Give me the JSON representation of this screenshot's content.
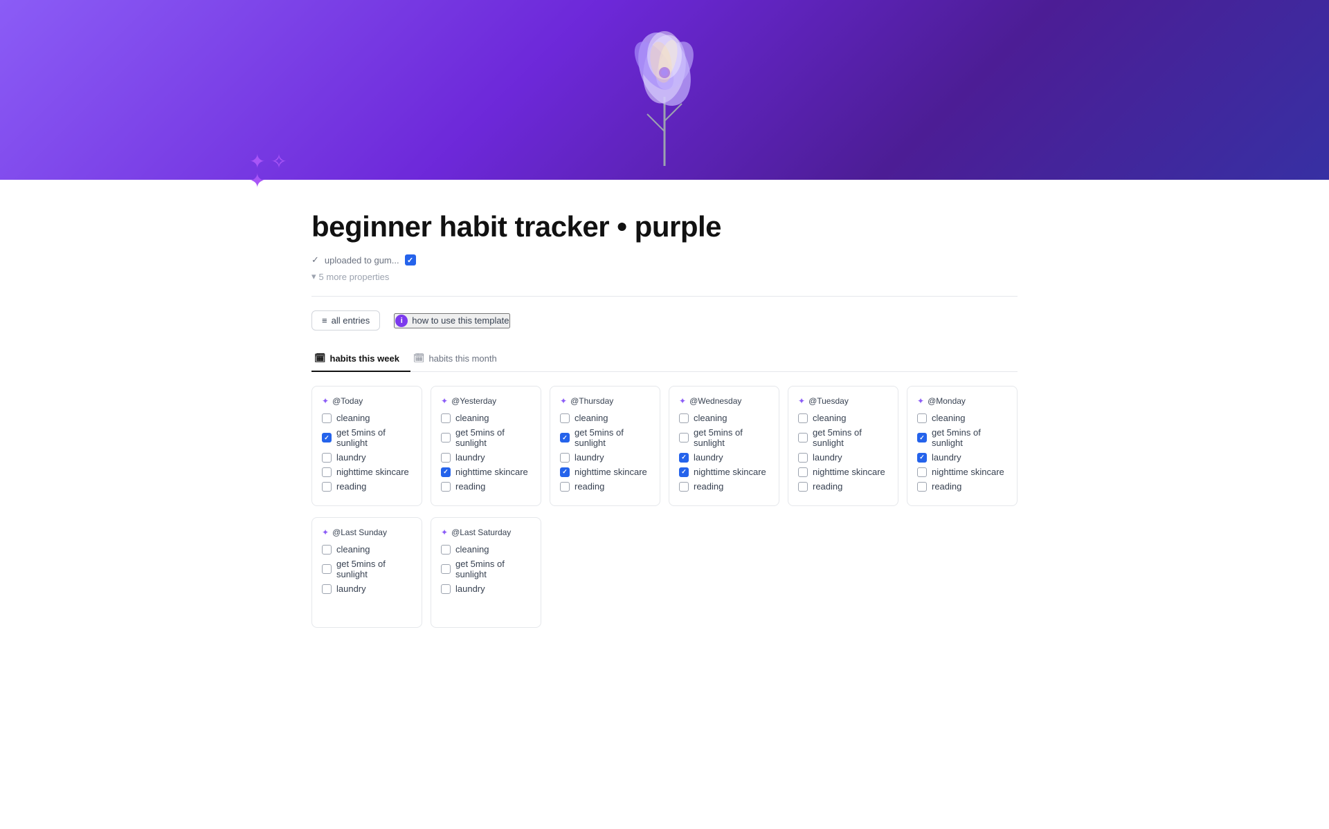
{
  "header": {
    "banner_gradient": "purple",
    "sparkles": "✦ ✧ ✦"
  },
  "page": {
    "title": "beginner habit tracker • purple",
    "property_label": "uploaded to gum...",
    "property_checked": true,
    "more_properties": "5 more properties"
  },
  "actions": {
    "all_entries_label": "all entries",
    "how_to_label": "how to use this template"
  },
  "tabs": [
    {
      "id": "week",
      "label": "habits this week",
      "active": true,
      "icon": "📅"
    },
    {
      "id": "month",
      "label": "habits this month",
      "active": false,
      "icon": "📅"
    }
  ],
  "habits_this_week": [
    {
      "day": "@Today",
      "habits": [
        {
          "label": "cleaning",
          "checked": false
        },
        {
          "label": "get 5mins of sunlight",
          "checked": true
        },
        {
          "label": "laundry",
          "checked": false
        },
        {
          "label": "nighttime skincare",
          "checked": false
        },
        {
          "label": "reading",
          "checked": false
        }
      ]
    },
    {
      "day": "@Yesterday",
      "habits": [
        {
          "label": "cleaning",
          "checked": false
        },
        {
          "label": "get 5mins of sunlight",
          "checked": false
        },
        {
          "label": "laundry",
          "checked": false
        },
        {
          "label": "nighttime skincare",
          "checked": true
        },
        {
          "label": "reading",
          "checked": false
        }
      ]
    },
    {
      "day": "@Thursday",
      "habits": [
        {
          "label": "cleaning",
          "checked": false
        },
        {
          "label": "get 5mins of sunlight",
          "checked": true
        },
        {
          "label": "laundry",
          "checked": false
        },
        {
          "label": "nighttime skincare",
          "checked": true
        },
        {
          "label": "reading",
          "checked": false
        }
      ]
    },
    {
      "day": "@Wednesday",
      "habits": [
        {
          "label": "cleaning",
          "checked": false
        },
        {
          "label": "get 5mins of sunlight",
          "checked": false
        },
        {
          "label": "laundry",
          "checked": true
        },
        {
          "label": "nighttime skincare",
          "checked": true
        },
        {
          "label": "reading",
          "checked": false
        }
      ]
    },
    {
      "day": "@Tuesday",
      "habits": [
        {
          "label": "cleaning",
          "checked": false
        },
        {
          "label": "get 5mins of sunlight",
          "checked": false
        },
        {
          "label": "laundry",
          "checked": false
        },
        {
          "label": "nighttime skincare",
          "checked": false
        },
        {
          "label": "reading",
          "checked": false
        }
      ]
    },
    {
      "day": "@Monday",
      "habits": [
        {
          "label": "cleaning",
          "checked": false
        },
        {
          "label": "get 5mins of sunlight",
          "checked": true
        },
        {
          "label": "laundry",
          "checked": true
        },
        {
          "label": "nighttime skincare",
          "checked": false
        },
        {
          "label": "reading",
          "checked": false
        }
      ]
    }
  ],
  "habits_bottom": [
    {
      "day": "@Last Sunday",
      "habits": [
        {
          "label": "cleaning",
          "checked": false
        },
        {
          "label": "get 5mins of sunlight",
          "checked": false
        },
        {
          "label": "laundry",
          "checked": false
        }
      ]
    },
    {
      "day": "@Last Saturday",
      "habits": [
        {
          "label": "cleaning",
          "checked": false
        },
        {
          "label": "get 5mins of sunlight",
          "checked": false
        },
        {
          "label": "laundry",
          "checked": false
        }
      ]
    }
  ]
}
